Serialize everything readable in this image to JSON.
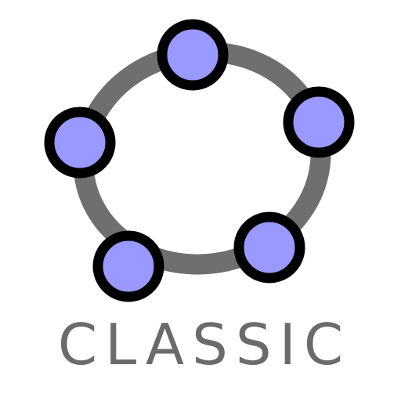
{
  "caption": "CLASSIC",
  "icon": "geogebra-ellipse-icon",
  "colors": {
    "curve": "#6f6f6f",
    "point_fill": "#9999ff",
    "point_stroke": "#000000",
    "caption": "#6b6b6b"
  }
}
